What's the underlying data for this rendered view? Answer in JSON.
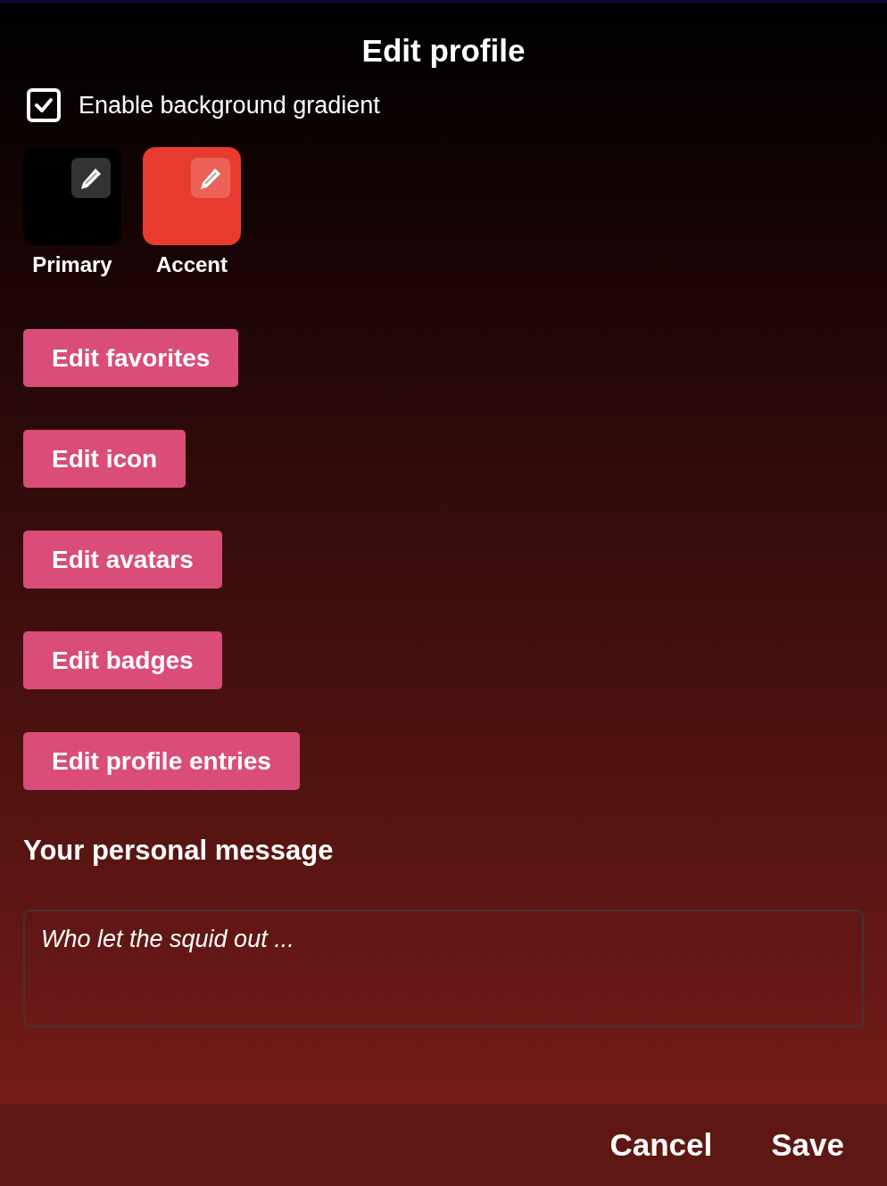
{
  "title": "Edit profile",
  "background_gradient": {
    "label": "Enable background gradient",
    "checked": true
  },
  "swatches": [
    {
      "label": "Primary",
      "color": "#000000"
    },
    {
      "label": "Accent",
      "color": "#e83b30"
    }
  ],
  "edit_buttons": [
    "Edit favorites",
    "Edit icon",
    "Edit avatars",
    "Edit badges",
    "Edit profile entries"
  ],
  "personal_message": {
    "heading": "Your personal message",
    "placeholder": "Who let the squid out ..."
  },
  "footer_buttons": [
    "Cancel",
    "Save"
  ]
}
